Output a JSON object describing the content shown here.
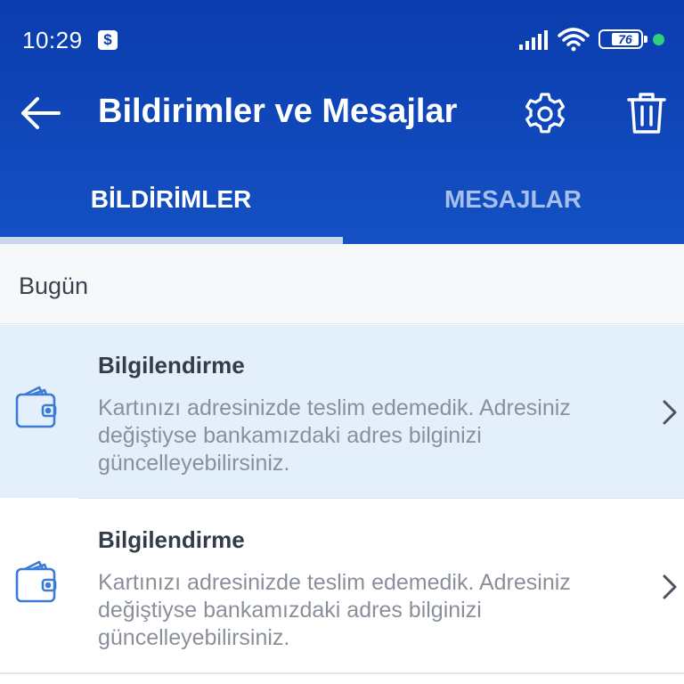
{
  "status_bar": {
    "time": "10:29",
    "badge_icon": "dollar-icon",
    "badge_symbol": "$",
    "battery_level": "76"
  },
  "app_bar": {
    "title": "Bildirimler ve Mesajlar",
    "back_icon": "arrow-left-icon",
    "settings_icon": "gear-icon",
    "delete_icon": "trash-icon"
  },
  "tabs": [
    {
      "label": "BİLDİRİMLER",
      "active": true
    },
    {
      "label": "MESAJLAR",
      "active": false
    }
  ],
  "section": {
    "title": "Bugün"
  },
  "notifications": [
    {
      "icon": "wallet-icon",
      "title": "Bilgilendirme",
      "body": "Kartınızı adresinizde teslim edemedik. Adresiniz değiştiyse bankamızdaki adres bilginizi güncelleyebilirsiniz.",
      "highlighted": true
    },
    {
      "icon": "wallet-icon",
      "title": "Bilgilendirme",
      "body": "Kartınızı adresinizde teslim edemedik. Adresiniz değiştiyse bankamızdaki adres bilginizi güncelleyebilirsiniz.",
      "highlighted": false
    }
  ],
  "colors": {
    "header": "#0b3cae",
    "header_bottom": "#1451c4",
    "highlight_row": "#e4effc",
    "icon_accent": "#3a7bd5",
    "status_dot": "#2fd07a"
  }
}
